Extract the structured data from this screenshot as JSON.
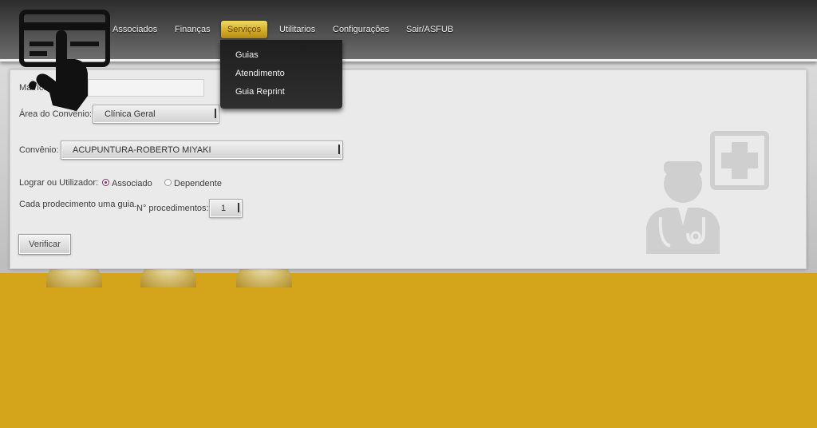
{
  "nav": {
    "items": [
      "Associados",
      "Finanças",
      "Serviços",
      "Utilitarios",
      "Configurações",
      "Sair/ASFUB"
    ],
    "active": "Serviços"
  },
  "dropdown": {
    "items": [
      "Guias",
      "Atendimento",
      "Guia Reprint"
    ]
  },
  "form": {
    "matricula_label": "Matrícula:",
    "matricula_value": "",
    "area_label": "Área do Convênio:",
    "area_value": "Clínica Geral",
    "convenio_label": "Convênio:",
    "convenio_value": "ACUPUNTURA-ROBERTO MIYAKI",
    "logrador_label": "Lograr ou Utilizador:",
    "radio_associado": "Associado",
    "radio_dependente": "Dependente",
    "radio_selected": "Associado",
    "cada_label": "Cada prodecimento uma guia.",
    "num_proc_label": "N° procedimentos:",
    "num_proc_value": "1",
    "verify_button": "Verificar"
  },
  "icons": {
    "logo": "card-hand-icon",
    "doctor": "doctor-medical-cross-icon"
  },
  "colors": {
    "background_gold": "#d4a51b",
    "nav_active": "#d4ad2a",
    "radio_selected": "#8a2a6c"
  }
}
